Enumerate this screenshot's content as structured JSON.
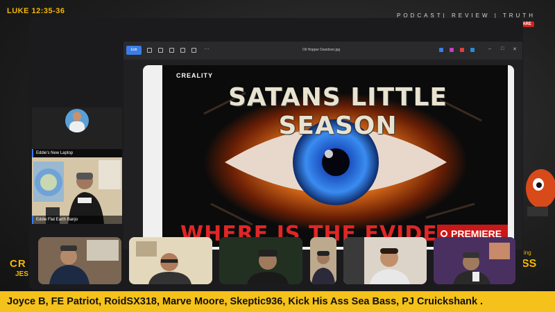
{
  "overlay": {
    "verse": "LUKE 12:35-36",
    "tagline": "PODCAST| REVIEW | TRUTH",
    "live_badge": "ARE",
    "left_brand": "CR",
    "left_brand_sub": "JES",
    "right_brand": "SS",
    "right_brand_sub": "ing"
  },
  "participants_sidebar": [
    {
      "label": "Eddie's New Laptop"
    },
    {
      "label": "Eddie Flat Earth Banjo"
    }
  ],
  "viewer": {
    "edit_label": "Edit",
    "file_name": "Oli Hopper Davidson.jpg",
    "more_label": "···",
    "minimize": "–",
    "maximize": "□",
    "close": "✕",
    "toolbar_icons": [
      "rotate-icon",
      "delete-icon",
      "print-icon",
      "crop-icon",
      "info-icon"
    ],
    "app_icon_colors": [
      "#3b7de8",
      "#c040c0",
      "#e04040",
      "#2a8ad8"
    ]
  },
  "poster": {
    "brand": "CREALITY",
    "title": "SATANS LITTLE SEASON",
    "subtitle": "WHERE IS THE EVIDENCE?",
    "badge": "PREMIERE",
    "colors": {
      "title": "#e8e2d0",
      "subtitle": "#e02626",
      "iris": "#2a6ee8"
    }
  },
  "ticker": {
    "text": "Joyce B, FE Patriot, RoidSX318, Marve Moore, Skeptic936, Kick His  Ass Sea Bass, PJ Cruickshank ."
  },
  "theme": {
    "accent": "#f5b800",
    "ticker_bg": "#f5c21b"
  }
}
